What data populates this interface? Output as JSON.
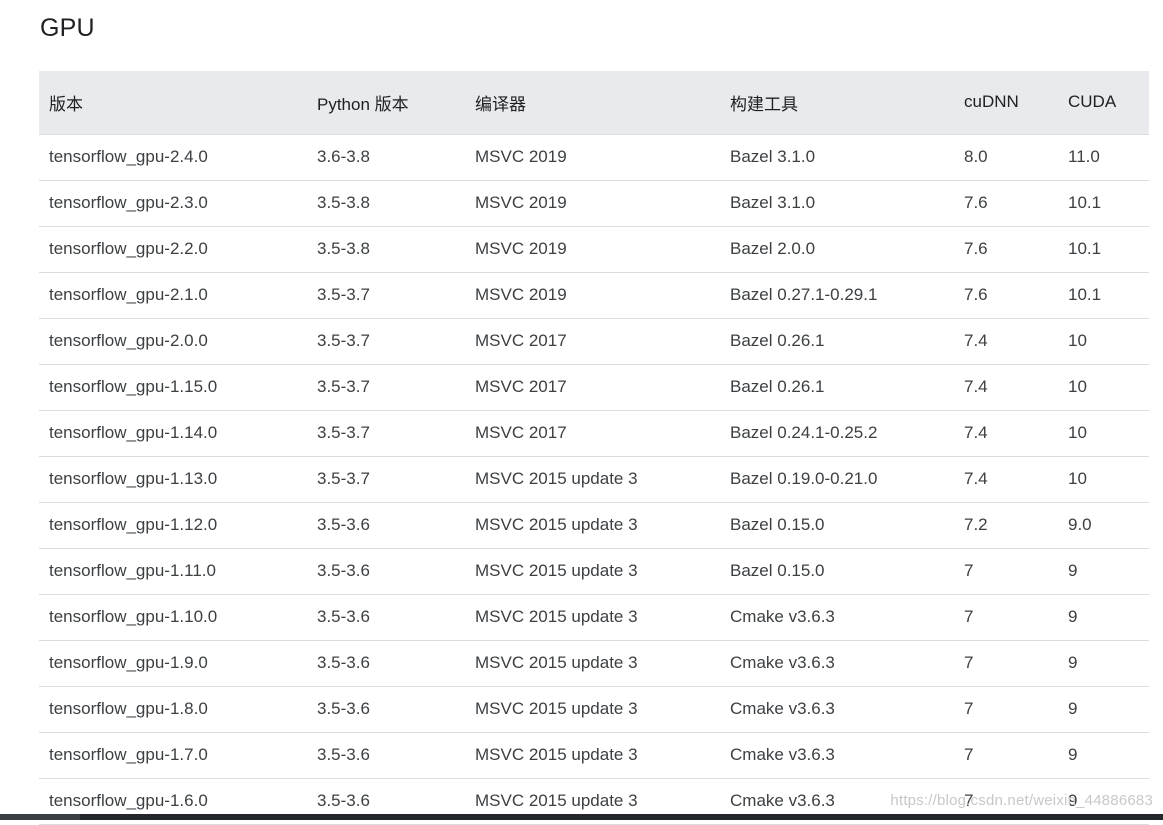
{
  "section": {
    "title": "GPU"
  },
  "table": {
    "headers": [
      "版本",
      "Python 版本",
      "编译器",
      "构建工具",
      "cuDNN",
      "CUDA"
    ],
    "rows": [
      [
        "tensorflow_gpu-2.4.0",
        "3.6-3.8",
        "MSVC 2019",
        "Bazel 3.1.0",
        "8.0",
        "11.0"
      ],
      [
        "tensorflow_gpu-2.3.0",
        "3.5-3.8",
        "MSVC 2019",
        "Bazel 3.1.0",
        "7.6",
        "10.1"
      ],
      [
        "tensorflow_gpu-2.2.0",
        "3.5-3.8",
        "MSVC 2019",
        "Bazel 2.0.0",
        "7.6",
        "10.1"
      ],
      [
        "tensorflow_gpu-2.1.0",
        "3.5-3.7",
        "MSVC 2019",
        "Bazel 0.27.1-0.29.1",
        "7.6",
        "10.1"
      ],
      [
        "tensorflow_gpu-2.0.0",
        "3.5-3.7",
        "MSVC 2017",
        "Bazel 0.26.1",
        "7.4",
        "10"
      ],
      [
        "tensorflow_gpu-1.15.0",
        "3.5-3.7",
        "MSVC 2017",
        "Bazel 0.26.1",
        "7.4",
        "10"
      ],
      [
        "tensorflow_gpu-1.14.0",
        "3.5-3.7",
        "MSVC 2017",
        "Bazel 0.24.1-0.25.2",
        "7.4",
        "10"
      ],
      [
        "tensorflow_gpu-1.13.0",
        "3.5-3.7",
        "MSVC 2015 update 3",
        "Bazel 0.19.0-0.21.0",
        "7.4",
        "10"
      ],
      [
        "tensorflow_gpu-1.12.0",
        "3.5-3.6",
        "MSVC 2015 update 3",
        "Bazel 0.15.0",
        "7.2",
        "9.0"
      ],
      [
        "tensorflow_gpu-1.11.0",
        "3.5-3.6",
        "MSVC 2015 update 3",
        "Bazel 0.15.0",
        "7",
        "9"
      ],
      [
        "tensorflow_gpu-1.10.0",
        "3.5-3.6",
        "MSVC 2015 update 3",
        "Cmake v3.6.3",
        "7",
        "9"
      ],
      [
        "tensorflow_gpu-1.9.0",
        "3.5-3.6",
        "MSVC 2015 update 3",
        "Cmake v3.6.3",
        "7",
        "9"
      ],
      [
        "tensorflow_gpu-1.8.0",
        "3.5-3.6",
        "MSVC 2015 update 3",
        "Cmake v3.6.3",
        "7",
        "9"
      ],
      [
        "tensorflow_gpu-1.7.0",
        "3.5-3.6",
        "MSVC 2015 update 3",
        "Cmake v3.6.3",
        "7",
        "9"
      ],
      [
        "tensorflow_gpu-1.6.0",
        "3.5-3.6",
        "MSVC 2015 update 3",
        "Cmake v3.6.3",
        "7",
        "9"
      ]
    ]
  },
  "watermark": {
    "text": "https://blog.csdn.net/weixin_44886683"
  },
  "colors": {
    "header_bg": "#e8eaed",
    "row_border": "#dadce0",
    "text": "#3c4043",
    "bottom_bar": "#23272b"
  }
}
